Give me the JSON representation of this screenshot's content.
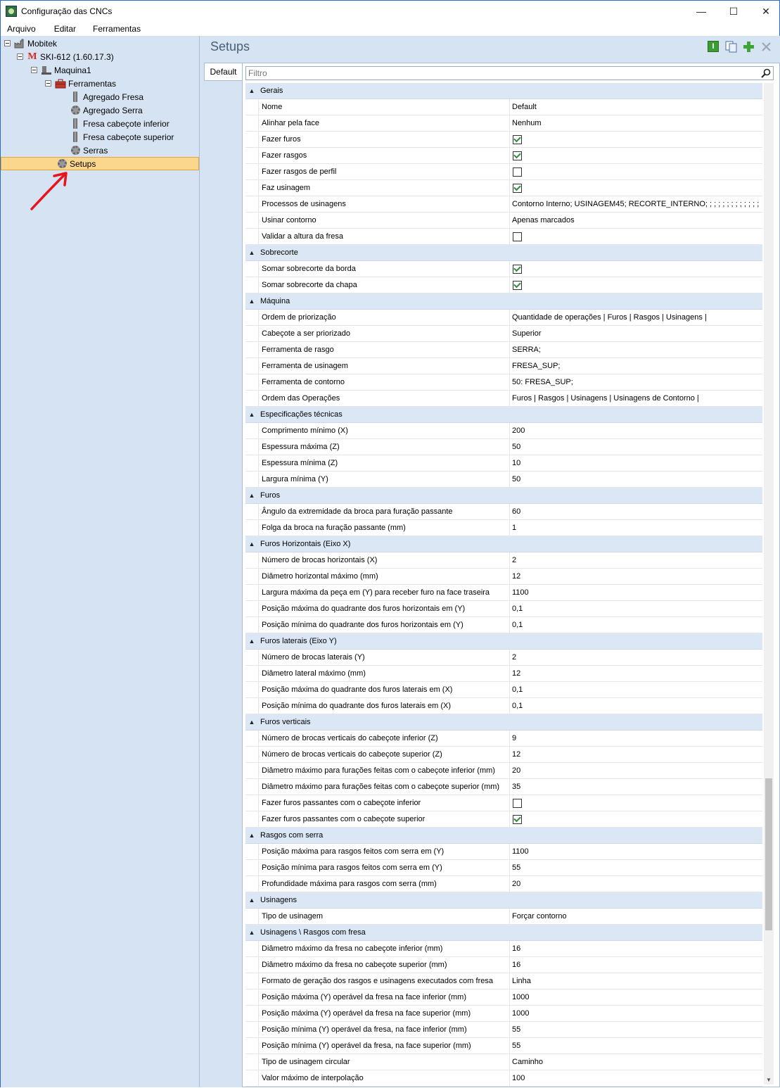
{
  "window": {
    "title": "Configuração das CNCs"
  },
  "menu": [
    "Arquivo",
    "Editar",
    "Ferramentas"
  ],
  "tree": [
    {
      "label": "Mobitek",
      "level": 0,
      "icon": "factory-icon",
      "expander": true
    },
    {
      "label": "SKI-612 (1.60.17.3)",
      "level": 1,
      "icon": "machine-brand-icon",
      "expander": true
    },
    {
      "label": "Maquina1",
      "level": 2,
      "icon": "machine-icon",
      "expander": true
    },
    {
      "label": "Ferramentas",
      "level": 3,
      "icon": "toolbox-icon",
      "expander": true
    },
    {
      "label": "Agregado Fresa",
      "level": 5,
      "icon": "mill-tool-icon"
    },
    {
      "label": "Agregado Serra",
      "level": 5,
      "icon": "saw-gear-icon"
    },
    {
      "label": "Fresa cabeçote inferior",
      "level": 5,
      "icon": "mill-tool-icon"
    },
    {
      "label": "Fresa cabeçote superior",
      "level": 5,
      "icon": "mill-tool-icon"
    },
    {
      "label": "Serras",
      "level": 5,
      "icon": "saw-gear-icon"
    },
    {
      "label": "Setups",
      "level": 4,
      "icon": "setup-gear-icon",
      "selected": true
    }
  ],
  "panel": {
    "title": "Setups",
    "tab": "Default",
    "filter_placeholder": "Filtro",
    "buttons": [
      "info-icon",
      "copy-icon",
      "add-icon",
      "delete-icon"
    ]
  },
  "groups": [
    {
      "name": "Gerais",
      "rows": [
        {
          "label": "Nome",
          "value": "Default"
        },
        {
          "label": "Alinhar pela face",
          "value": "Nenhum"
        },
        {
          "label": "Fazer furos",
          "check": true
        },
        {
          "label": "Fazer rasgos",
          "check": true
        },
        {
          "label": "Fazer rasgos de perfil",
          "check": false
        },
        {
          "label": "Faz usinagem",
          "check": true
        },
        {
          "label": "Processos de usinagens",
          "value": "Contorno Interno; USINAGEM45; RECORTE_INTERNO; ; ; ; ; ; ; ; ; ; ; ; ;"
        },
        {
          "label": "Usinar contorno",
          "value": "Apenas marcados"
        },
        {
          "label": "Validar a altura da fresa",
          "check": false
        }
      ]
    },
    {
      "name": "Sobrecorte",
      "rows": [
        {
          "label": "Somar sobrecorte da borda",
          "check": true
        },
        {
          "label": "Somar sobrecorte da chapa",
          "check": true
        }
      ]
    },
    {
      "name": "Máquina",
      "rows": [
        {
          "label": "Ordem de priorização",
          "value": "Quantidade de operações | Furos | Rasgos | Usinagens |"
        },
        {
          "label": "Cabeçote a ser priorizado",
          "value": "Superior"
        },
        {
          "label": "Ferramenta de rasgo",
          "value": "SERRA;"
        },
        {
          "label": "Ferramenta de usinagem",
          "value": "FRESA_SUP;"
        },
        {
          "label": "Ferramenta de contorno",
          "value": "50: FRESA_SUP;"
        },
        {
          "label": "Ordem das Operações",
          "value": "Furos | Rasgos | Usinagens | Usinagens de Contorno |"
        }
      ]
    },
    {
      "name": "Especificações técnicas",
      "rows": [
        {
          "label": "Comprimento mínimo (X)",
          "value": "200"
        },
        {
          "label": "Espessura máxima (Z)",
          "value": "50"
        },
        {
          "label": "Espessura mínima (Z)",
          "value": "10"
        },
        {
          "label": "Largura mínima (Y)",
          "value": "50"
        }
      ]
    },
    {
      "name": "Furos",
      "rows": [
        {
          "label": "Ângulo da extremidade da broca para furação passante",
          "value": "60"
        },
        {
          "label": "Folga da broca na furação passante (mm)",
          "value": "1"
        }
      ]
    },
    {
      "name": "Furos Horizontais (Eixo X)",
      "rows": [
        {
          "label": "Número de brocas horizontais (X)",
          "value": "2"
        },
        {
          "label": "Diâmetro horizontal máximo (mm)",
          "value": "12"
        },
        {
          "label": "Largura máxima da peça em (Y) para receber furo na face traseira",
          "value": "1100"
        },
        {
          "label": "Posição máxima do quadrante dos furos horizontais em (Y)",
          "value": "0,1"
        },
        {
          "label": "Posição mínima do quadrante dos furos horizontais em (Y)",
          "value": "0,1"
        }
      ]
    },
    {
      "name": "Furos laterais (Eixo Y)",
      "rows": [
        {
          "label": "Número de brocas laterais (Y)",
          "value": "2"
        },
        {
          "label": "Diâmetro lateral máximo (mm)",
          "value": "12"
        },
        {
          "label": "Posição máxima do quadrante dos furos laterais em (X)",
          "value": "0,1"
        },
        {
          "label": "Posição mínima do quadrante dos furos laterais em (X)",
          "value": "0,1"
        }
      ]
    },
    {
      "name": "Furos verticais",
      "rows": [
        {
          "label": "Número de brocas verticais do cabeçote inferior (Z)",
          "value": "9"
        },
        {
          "label": "Número de brocas verticais do cabeçote superior (Z)",
          "value": "12"
        },
        {
          "label": "Diâmetro máximo para furações feitas com o cabeçote inferior (mm)",
          "value": "20"
        },
        {
          "label": "Diâmetro máximo para furações feitas com o cabeçote superior (mm)",
          "value": "35"
        },
        {
          "label": "Fazer furos passantes com o cabeçote inferior",
          "check": false
        },
        {
          "label": "Fazer furos passantes com o cabeçote superior",
          "check": true
        }
      ]
    },
    {
      "name": "Rasgos com serra",
      "rows": [
        {
          "label": "Posição máxima para rasgos feitos com serra em (Y)",
          "value": "1100"
        },
        {
          "label": "Posição mínima para rasgos feitos com serra em (Y)",
          "value": "55"
        },
        {
          "label": "Profundidade máxima para rasgos com serra (mm)",
          "value": "20"
        }
      ]
    },
    {
      "name": "Usinagens",
      "rows": [
        {
          "label": "Tipo de usinagem",
          "value": "Forçar contorno"
        }
      ]
    },
    {
      "name": "Usinagens \\ Rasgos com fresa",
      "rows": [
        {
          "label": "Diâmetro máximo da fresa no cabeçote inferior (mm)",
          "value": "16"
        },
        {
          "label": "Diâmetro máximo da fresa no cabeçote superior (mm)",
          "value": "16"
        },
        {
          "label": "Formato de geração dos rasgos e usinagens executados com fresa",
          "value": "Linha"
        },
        {
          "label": "Posição máxima (Y) operável da fresa na face inferior (mm)",
          "value": "1000"
        },
        {
          "label": "Posição máxima (Y) operável da fresa na face superior (mm)",
          "value": "1000"
        },
        {
          "label": "Posição mínima (Y) operável da fresa, na face inferior (mm)",
          "value": "55"
        },
        {
          "label": "Posição mínima (Y) operável da fresa, na face superior (mm)",
          "value": "55"
        },
        {
          "label": "Tipo de usinagem circular",
          "value": "Caminho"
        },
        {
          "label": "Valor máximo de interpolação",
          "value": "100"
        }
      ]
    }
  ],
  "colors": {
    "selection": "#fbd78d",
    "panel_bg": "#d6e3f3",
    "category_bg": "#dce7f5",
    "check_mark": "#2f8c3a",
    "annotation_arrow": "#e8141b"
  }
}
